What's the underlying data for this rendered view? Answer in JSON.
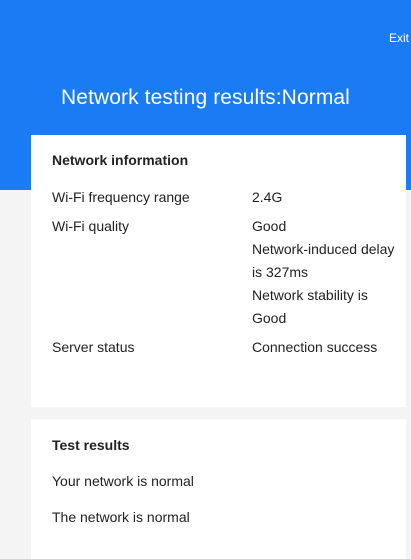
{
  "header": {
    "exit_label": "Exit",
    "title": "Network testing results:Normal",
    "background": "#1a7cf5"
  },
  "network_info": {
    "title": "Network information",
    "rows": [
      {
        "label": "Wi-Fi frequency range",
        "values": [
          "2.4G"
        ]
      },
      {
        "label": "Wi-Fi quality",
        "values": [
          "Good",
          "Network-induced delay is 327ms",
          "Network stability is Good"
        ]
      },
      {
        "label": "Server status",
        "values": [
          "Connection success"
        ]
      }
    ]
  },
  "test_results": {
    "title": "Test results",
    "lines": [
      "Your network is normal",
      "The network is normal"
    ]
  }
}
